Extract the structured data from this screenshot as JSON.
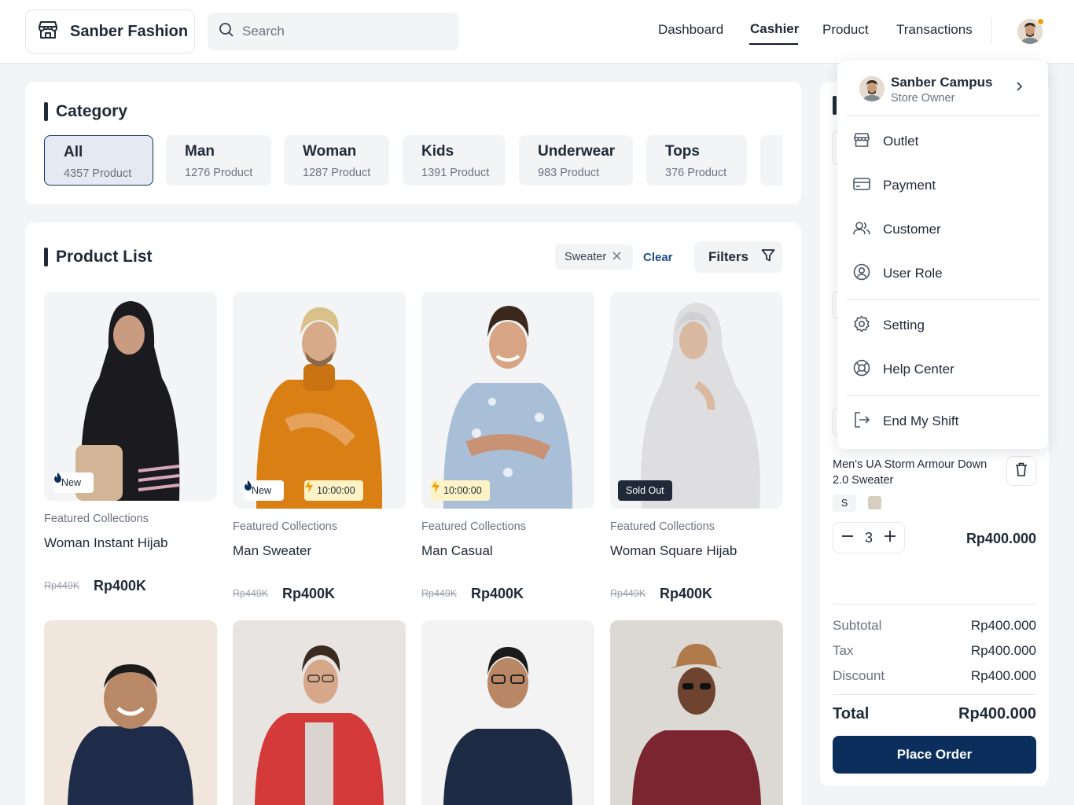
{
  "header": {
    "brand": "Sanber Fashion",
    "search_placeholder": "Search",
    "nav": [
      "Dashboard",
      "Cashier",
      "Product",
      "Transactions"
    ],
    "active_nav": "Cashier"
  },
  "category": {
    "title": "Category",
    "items": [
      {
        "name": "All",
        "count": "4357 Product"
      },
      {
        "name": "Man",
        "count": "1276 Product"
      },
      {
        "name": "Woman",
        "count": "1287 Product"
      },
      {
        "name": "Kids",
        "count": "1391 Product"
      },
      {
        "name": "Underwear",
        "count": "983 Product"
      },
      {
        "name": "Tops",
        "count": "376 Product"
      }
    ]
  },
  "product_list": {
    "title": "Product List",
    "filter_chip": "Sweater",
    "clear_label": "Clear",
    "filters_label": "Filters",
    "products": [
      {
        "collection": "Featured Collections",
        "name": "Woman Instant Hijab",
        "old_price": "Rp449K",
        "price": "Rp400K",
        "badge_new": "New"
      },
      {
        "collection": "Featured Collections",
        "name": "Man Sweater",
        "old_price": "Rp449K",
        "price": "Rp400K",
        "badge_new": "New",
        "timer": "10:00:00"
      },
      {
        "collection": "Featured Collections",
        "name": "Man Casual",
        "old_price": "Rp449K",
        "price": "Rp400K",
        "timer": "10:00:00"
      },
      {
        "collection": "Featured Collections",
        "name": "Woman Square Hijab",
        "old_price": "Rp449K",
        "price": "Rp400K",
        "sold_out": "Sold Out"
      }
    ]
  },
  "order": {
    "item_name": "Men's UA Storm Armour Down 2.0 Sweater",
    "size": "S",
    "swatch_color": "#d6cebf",
    "quantity": "3",
    "line_price": "Rp400.000",
    "summary": [
      {
        "label": "Subtotal",
        "value": "Rp400.000"
      },
      {
        "label": "Tax",
        "value": "Rp400.000"
      },
      {
        "label": "Discount",
        "value": "Rp400.000"
      }
    ],
    "total_label": "Total",
    "total_value": "Rp400.000",
    "place_order": "Place Order"
  },
  "profile_menu": {
    "name": "Sanber Campus",
    "role": "Store Owner",
    "items": [
      {
        "label": "Outlet",
        "icon": "store-icon"
      },
      {
        "label": "Payment",
        "icon": "credit-card-icon"
      },
      {
        "label": "Customer",
        "icon": "users-icon"
      },
      {
        "label": "User Role",
        "icon": "user-circle-icon"
      },
      {
        "label": "Setting",
        "icon": "gear-icon"
      },
      {
        "label": "Help Center",
        "icon": "lifebuoy-icon"
      },
      {
        "label": "End My Shift",
        "icon": "logout-icon"
      }
    ]
  },
  "colors": {
    "primary": "#0b2e5c",
    "accent": "#f59e0b",
    "background": "#f3f4f6"
  }
}
